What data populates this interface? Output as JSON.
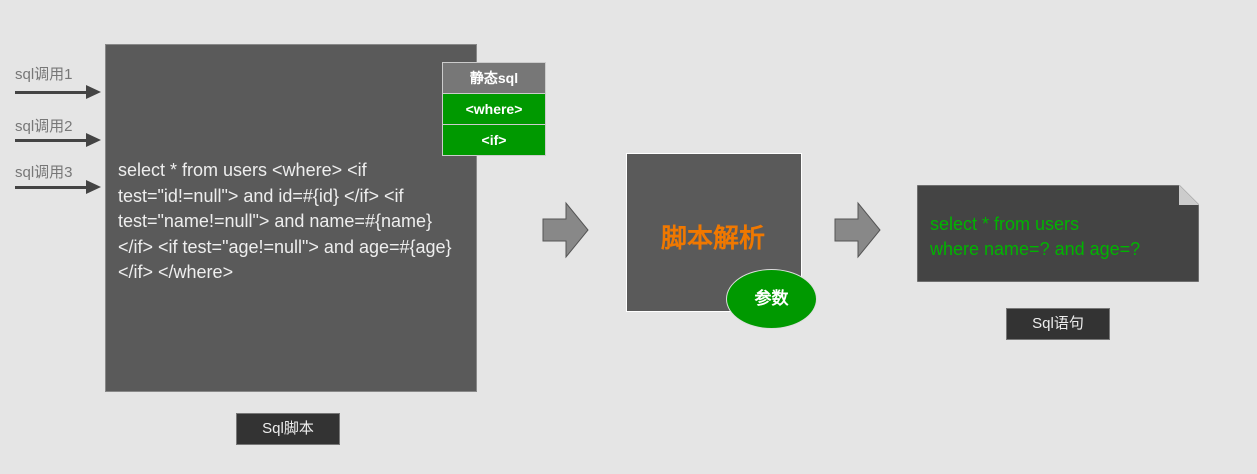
{
  "calls": [
    "sql调用1",
    "sql调用2",
    "sql调用3"
  ],
  "script": {
    "code": "select * from users <where> <if test=\"id!=null\"> and id=#{id} </if> <if test=\"name!=null\"> and name=#{name} </if> <if test=\"age!=null\"> and age=#{age} </if> </where>",
    "tags": [
      "静态sql",
      "<where>",
      "<if>"
    ],
    "caption": "Sql脚本"
  },
  "parser": {
    "title": "脚本解析",
    "params": "参数"
  },
  "output": {
    "lines": [
      "select * from users",
      "where name=? and age=?"
    ],
    "caption": "Sql语句"
  },
  "colors": {
    "background": "#e5e5e5",
    "box": "#5a5a5a",
    "green": "#009900",
    "orange": "#f07800",
    "code_green": "#00b400"
  }
}
